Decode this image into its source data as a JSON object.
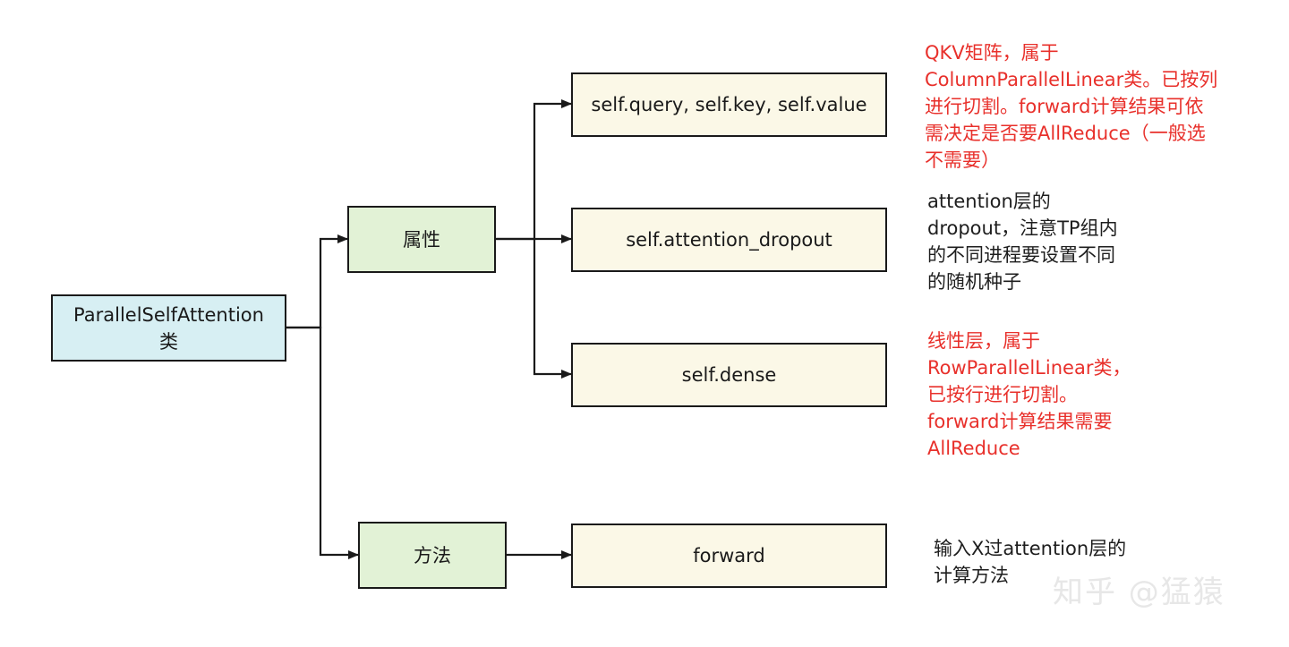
{
  "nodes": {
    "root": {
      "line1": "ParallelSelfAttention",
      "line2": "类"
    },
    "attributes": "属性",
    "methods": "方法",
    "qkv": "self.query, self.key, self.value",
    "attention_dropout": "self.attention_dropout",
    "dense": "self.dense",
    "forward": "forward"
  },
  "notes": {
    "qkv": [
      "QKV矩阵，属于",
      "ColumnParallelLinear类。已按列",
      "进行切割。forward计算结果可依",
      "需决定是否要AllReduce（一般选",
      "不需要）"
    ],
    "attention_dropout": [
      "attention层的",
      "dropout，注意TP组内",
      "的不同进程要设置不同",
      "的随机种子"
    ],
    "dense": [
      "线性层，属于",
      "RowParallelLinear类，",
      "已按行进行切割。",
      "forward计算结果需要",
      "AllReduce"
    ],
    "forward": [
      "输入X过attention层的",
      "计算方法"
    ]
  },
  "watermark": "知乎 @猛猿",
  "colors": {
    "class_box": "#d7eff3",
    "group_box": "#e2f2d6",
    "leaf_box": "#fbf8e7",
    "red_note": "#e8302b",
    "connector": "#1a1a1a"
  }
}
